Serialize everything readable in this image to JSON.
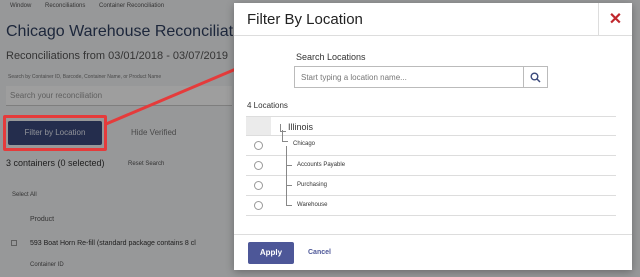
{
  "background": {
    "breadcrumbs": [
      "Window",
      "Reconciliations",
      "Container Reconciliation"
    ],
    "title": "Chicago Warehouse Reconciliati",
    "date_range": "Reconciliations from 03/01/2018 - 03/07/2019",
    "search_label": "Search by Container ID, Barcode, Container Name, or Product Name",
    "search_placeholder": "Search your reconciliation",
    "filter_button": "Filter by Location",
    "hide_verified": "Hide Verified",
    "count_text": "3 containers (0 selected)",
    "reset_search": "Reset Search",
    "select_all": "Select All",
    "product_header": "Product",
    "product_row": "593 Boat Horn Re-fill (standard package contains 8 cl",
    "container_id": "Container ID"
  },
  "modal": {
    "title": "Filter By Location",
    "close_symbol": "✕",
    "search_label": "Search Locations",
    "search_placeholder": "Start typing a location name...",
    "count_label": "4 Locations",
    "root": "Illinois",
    "locations": [
      "Chicago",
      "Accounts Payable",
      "Purchasing",
      "Warehouse"
    ],
    "apply_label": "Apply",
    "cancel_label": "Cancel"
  },
  "colors": {
    "primary_button": "#4d5798",
    "close_icon": "#c0272d",
    "highlight": "#e53b3b"
  },
  "icons": [
    "search-icon",
    "close-icon"
  ]
}
